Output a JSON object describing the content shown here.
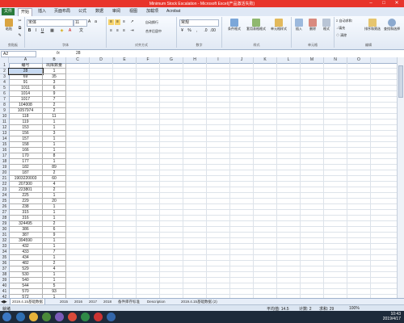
{
  "window": {
    "title": "Minimum Stock Escalation - Microsoft Excel(产品激活失败)"
  },
  "tabs": [
    "文件",
    "开始",
    "插入",
    "页面布局",
    "公式",
    "数据",
    "审阅",
    "视图",
    "加载项",
    "Acrobat"
  ],
  "ribbon": {
    "paste": "粘贴",
    "clipboard": "剪贴板",
    "font_name": "宋体",
    "font_size": "11",
    "font_group": "字体",
    "wrap": "自动换行",
    "merge": "合并后居中",
    "align_group": "对齐方式",
    "number_format": "常规",
    "number_group": "数字",
    "cond_format": "条件格式",
    "table_format": "套用表格格式",
    "cell_style": "单元格样式",
    "styles_group": "样式",
    "insert": "插入",
    "delete": "删除",
    "format": "格式",
    "cells_group": "单元格",
    "autosum": "自动求和",
    "fill": "填充",
    "clear": "清除",
    "sort": "排序和筛选",
    "find": "查找和选择",
    "edit_group": "编辑"
  },
  "formula_bar": {
    "cell": "A2",
    "fx": "fx",
    "value": "28"
  },
  "columns": [
    "A",
    "B",
    "C",
    "D",
    "E",
    "F",
    "G",
    "H",
    "I",
    "J",
    "K",
    "L",
    "M",
    "N",
    "O"
  ],
  "rows": [
    [
      "编号",
      "出库数量"
    ],
    [
      "28",
      "1"
    ],
    [
      "69",
      "35"
    ],
    [
      "91",
      "3"
    ],
    [
      "1011",
      "6"
    ],
    [
      "1014",
      "9"
    ],
    [
      "1017",
      "7"
    ],
    [
      "104008",
      "2"
    ],
    [
      "1057974",
      "2"
    ],
    [
      "118",
      "11"
    ],
    [
      "119",
      "1"
    ],
    [
      "153",
      "1"
    ],
    [
      "156",
      "3"
    ],
    [
      "157",
      "1"
    ],
    [
      "158",
      "1"
    ],
    [
      "166",
      "1"
    ],
    [
      "170",
      "8"
    ],
    [
      "177",
      "1"
    ],
    [
      "182",
      "89"
    ],
    [
      "187",
      "2"
    ],
    [
      "1903220003",
      "60"
    ],
    [
      "207300",
      "4"
    ],
    [
      "223801",
      "2"
    ],
    [
      "225",
      "1"
    ],
    [
      "229",
      "20"
    ],
    [
      "238",
      "1"
    ],
    [
      "315",
      "1"
    ],
    [
      "316",
      "1"
    ],
    [
      "324495",
      "2"
    ],
    [
      "386",
      "6"
    ],
    [
      "387",
      "9"
    ],
    [
      "394590",
      "1"
    ],
    [
      "432",
      "1"
    ],
    [
      "433",
      "7"
    ],
    [
      "434",
      "1"
    ],
    [
      "482",
      "2"
    ],
    [
      "529",
      "4"
    ],
    [
      "530",
      "1"
    ],
    [
      "540",
      "1"
    ],
    [
      "544",
      "5"
    ],
    [
      "570",
      "93"
    ],
    [
      "572",
      "1"
    ]
  ],
  "sheet_tabs": [
    "2019.4.15基础数据",
    "2015",
    "2016",
    "2017",
    "2018",
    "备件库存标准",
    "Description",
    "2019.4.15基础数据 (2)"
  ],
  "status": {
    "ready": "就绪",
    "average": "平均值: 14.5",
    "count": "计数: 2",
    "sum": "求和: 29",
    "zoom": "100%"
  },
  "taskbar": {
    "time": "10:43",
    "date": "2019/4/17"
  },
  "colors": {
    "title_red": "#e8342b",
    "file_green": "#2a7a3a"
  }
}
